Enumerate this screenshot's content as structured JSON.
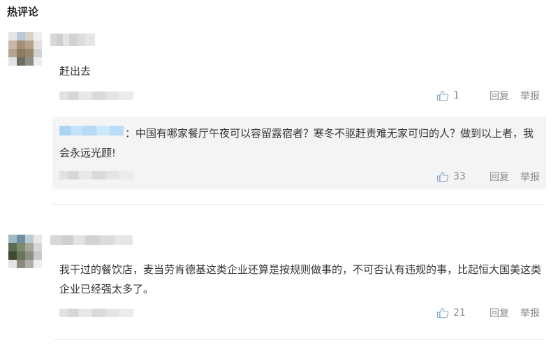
{
  "section": {
    "title": "热评论"
  },
  "comments": [
    {
      "text": "赶出去",
      "like_count": "1",
      "reply_label": "回复",
      "report_label": "举报",
      "quoted_reply": {
        "text": "：中国有哪家餐厅午夜可以容留露宿者？寒冬不驱赶责难无家可归的人？做到以上者，我会永远光顾!",
        "like_count": "33",
        "reply_label": "回复",
        "report_label": "举报"
      }
    },
    {
      "text": "我干过的餐饮店，麦当劳肯德基这类企业还算是按规则做事的，不可否认有违规的事，比起恒大国美这类企业已经强太多了。",
      "like_count": "21",
      "reply_label": "回复",
      "report_label": "举报"
    }
  ],
  "colors": {
    "text": "#333333",
    "muted": "#8a8a8a",
    "reply_bg": "#f4f4f4",
    "username_blur": "#a9d4f2"
  }
}
